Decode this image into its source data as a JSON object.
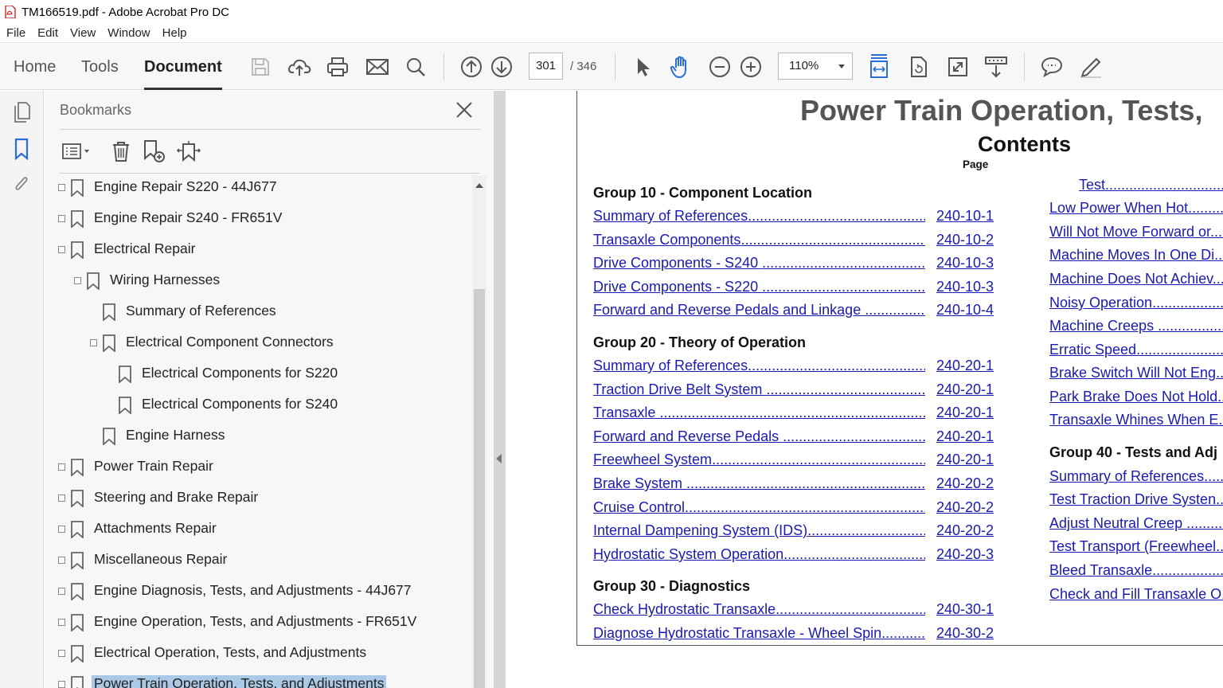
{
  "window": {
    "title": "TM166519.pdf - Adobe Acrobat Pro DC"
  },
  "menu": [
    "File",
    "Edit",
    "View",
    "Window",
    "Help"
  ],
  "nav_tabs": [
    "Home",
    "Tools",
    "Document"
  ],
  "page_nav": {
    "current": "301",
    "total": "/ 346"
  },
  "zoom": "110%",
  "bookmarks_panel": {
    "title": "Bookmarks",
    "items": [
      {
        "label": "Engine Repair S220 - 44J677",
        "level": 0,
        "expander": true
      },
      {
        "label": "Engine Repair S240 - FR651V",
        "level": 0,
        "expander": true
      },
      {
        "label": "Electrical Repair",
        "level": 0,
        "expander": true
      },
      {
        "label": "Wiring Harnesses",
        "level": 1,
        "expander": true
      },
      {
        "label": "Summary of References",
        "level": 2,
        "expander": false
      },
      {
        "label": "Electrical Component Connectors",
        "level": 2,
        "expander": true
      },
      {
        "label": "Electrical Components for S220",
        "level": 3,
        "expander": false
      },
      {
        "label": "Electrical Components for S240",
        "level": 3,
        "expander": false
      },
      {
        "label": "Engine Harness",
        "level": 2,
        "expander": false
      },
      {
        "label": "Power Train Repair",
        "level": 0,
        "expander": true
      },
      {
        "label": "Steering and Brake Repair",
        "level": 0,
        "expander": true
      },
      {
        "label": "Attachments Repair",
        "level": 0,
        "expander": true
      },
      {
        "label": "Miscellaneous Repair",
        "level": 0,
        "expander": true
      },
      {
        "label": "Engine Diagnosis, Tests, and Adjustments - 44J677",
        "level": 0,
        "expander": true
      },
      {
        "label": "Engine Operation, Tests, and Adjustments - FR651V",
        "level": 0,
        "expander": true
      },
      {
        "label": "Electrical Operation, Tests, and Adjustments",
        "level": 0,
        "expander": true
      },
      {
        "label": "Power Train Operation, Tests, and Adjustments",
        "level": 0,
        "expander": true,
        "selected": true
      }
    ]
  },
  "document": {
    "title": "Power Train Operation, Tests,",
    "contents_heading": "Contents",
    "page_header": "Page",
    "left_groups": [
      {
        "heading": "Group 10 - Component Location",
        "entries": [
          {
            "text": "Summary of References",
            "page": "240-10-1"
          },
          {
            "text": "Transaxle Components",
            "page": "240-10-2"
          },
          {
            "text": "Drive Components - S240 ",
            "page": "240-10-3"
          },
          {
            "text": "Drive Components - S220 ",
            "page": "240-10-3"
          },
          {
            "text": "Forward and Reverse Pedals and Linkage ",
            "page": "240-10-4"
          }
        ]
      },
      {
        "heading": "Group 20 - Theory of Operation",
        "entries": [
          {
            "text": "Summary of References",
            "page": "240-20-1"
          },
          {
            "text": "Traction Drive Belt System ",
            "page": "240-20-1"
          },
          {
            "text": "Transaxle ",
            "page": "240-20-1"
          },
          {
            "text": "Forward and Reverse Pedals ",
            "page": "240-20-1"
          },
          {
            "text": "Freewheel System",
            "page": "240-20-1"
          },
          {
            "text": "Brake System ",
            "page": "240-20-2"
          },
          {
            "text": "Cruise Control",
            "page": "240-20-2"
          },
          {
            "text": "Internal Dampening System (IDS)",
            "page": "240-20-2"
          },
          {
            "text": "Hydrostatic System Operation",
            "page": "240-20-3"
          }
        ]
      },
      {
        "heading": "Group 30 - Diagnostics",
        "entries": [
          {
            "text": "Check Hydrostatic Transaxle",
            "page": "240-30-1"
          },
          {
            "text": "Diagnose  Hydrostatic  Transaxle  -  Wheel  Spin",
            "page": "240-30-2"
          }
        ]
      }
    ],
    "right_column": [
      {
        "type": "entry",
        "text": "Test"
      },
      {
        "type": "entry",
        "text": "Low Power When Hot"
      },
      {
        "type": "entry",
        "text": "Will Not Move Forward or"
      },
      {
        "type": "entry",
        "text": "Machine Moves In One Di"
      },
      {
        "type": "entry",
        "text": "Machine Does Not Achiev"
      },
      {
        "type": "entry",
        "text": "Noisy Operation"
      },
      {
        "type": "entry",
        "text": "Machine Creeps "
      },
      {
        "type": "entry",
        "text": "Erratic Speed"
      },
      {
        "type": "entry",
        "text": "Brake Switch Will Not Eng"
      },
      {
        "type": "entry",
        "text": "Park Brake Does Not Hold"
      },
      {
        "type": "entry",
        "text": "Transaxle Whines When E"
      },
      {
        "type": "heading",
        "text": "Group 40 - Tests and Adj"
      },
      {
        "type": "entry",
        "text": "Summary of References"
      },
      {
        "type": "entry",
        "text": "Test Traction Drive Systen"
      },
      {
        "type": "entry",
        "text": "Adjust Neutral Creep "
      },
      {
        "type": "entry",
        "text": "Test Transport (Freewheel"
      },
      {
        "type": "entry",
        "text": "Bleed Transaxle"
      },
      {
        "type": "entry",
        "text": "Check and Fill Transaxle O"
      }
    ]
  },
  "colors": {
    "link": "#1a1ab0",
    "selection": "#a9c9e6",
    "active_icon": "#2a6fd6"
  }
}
